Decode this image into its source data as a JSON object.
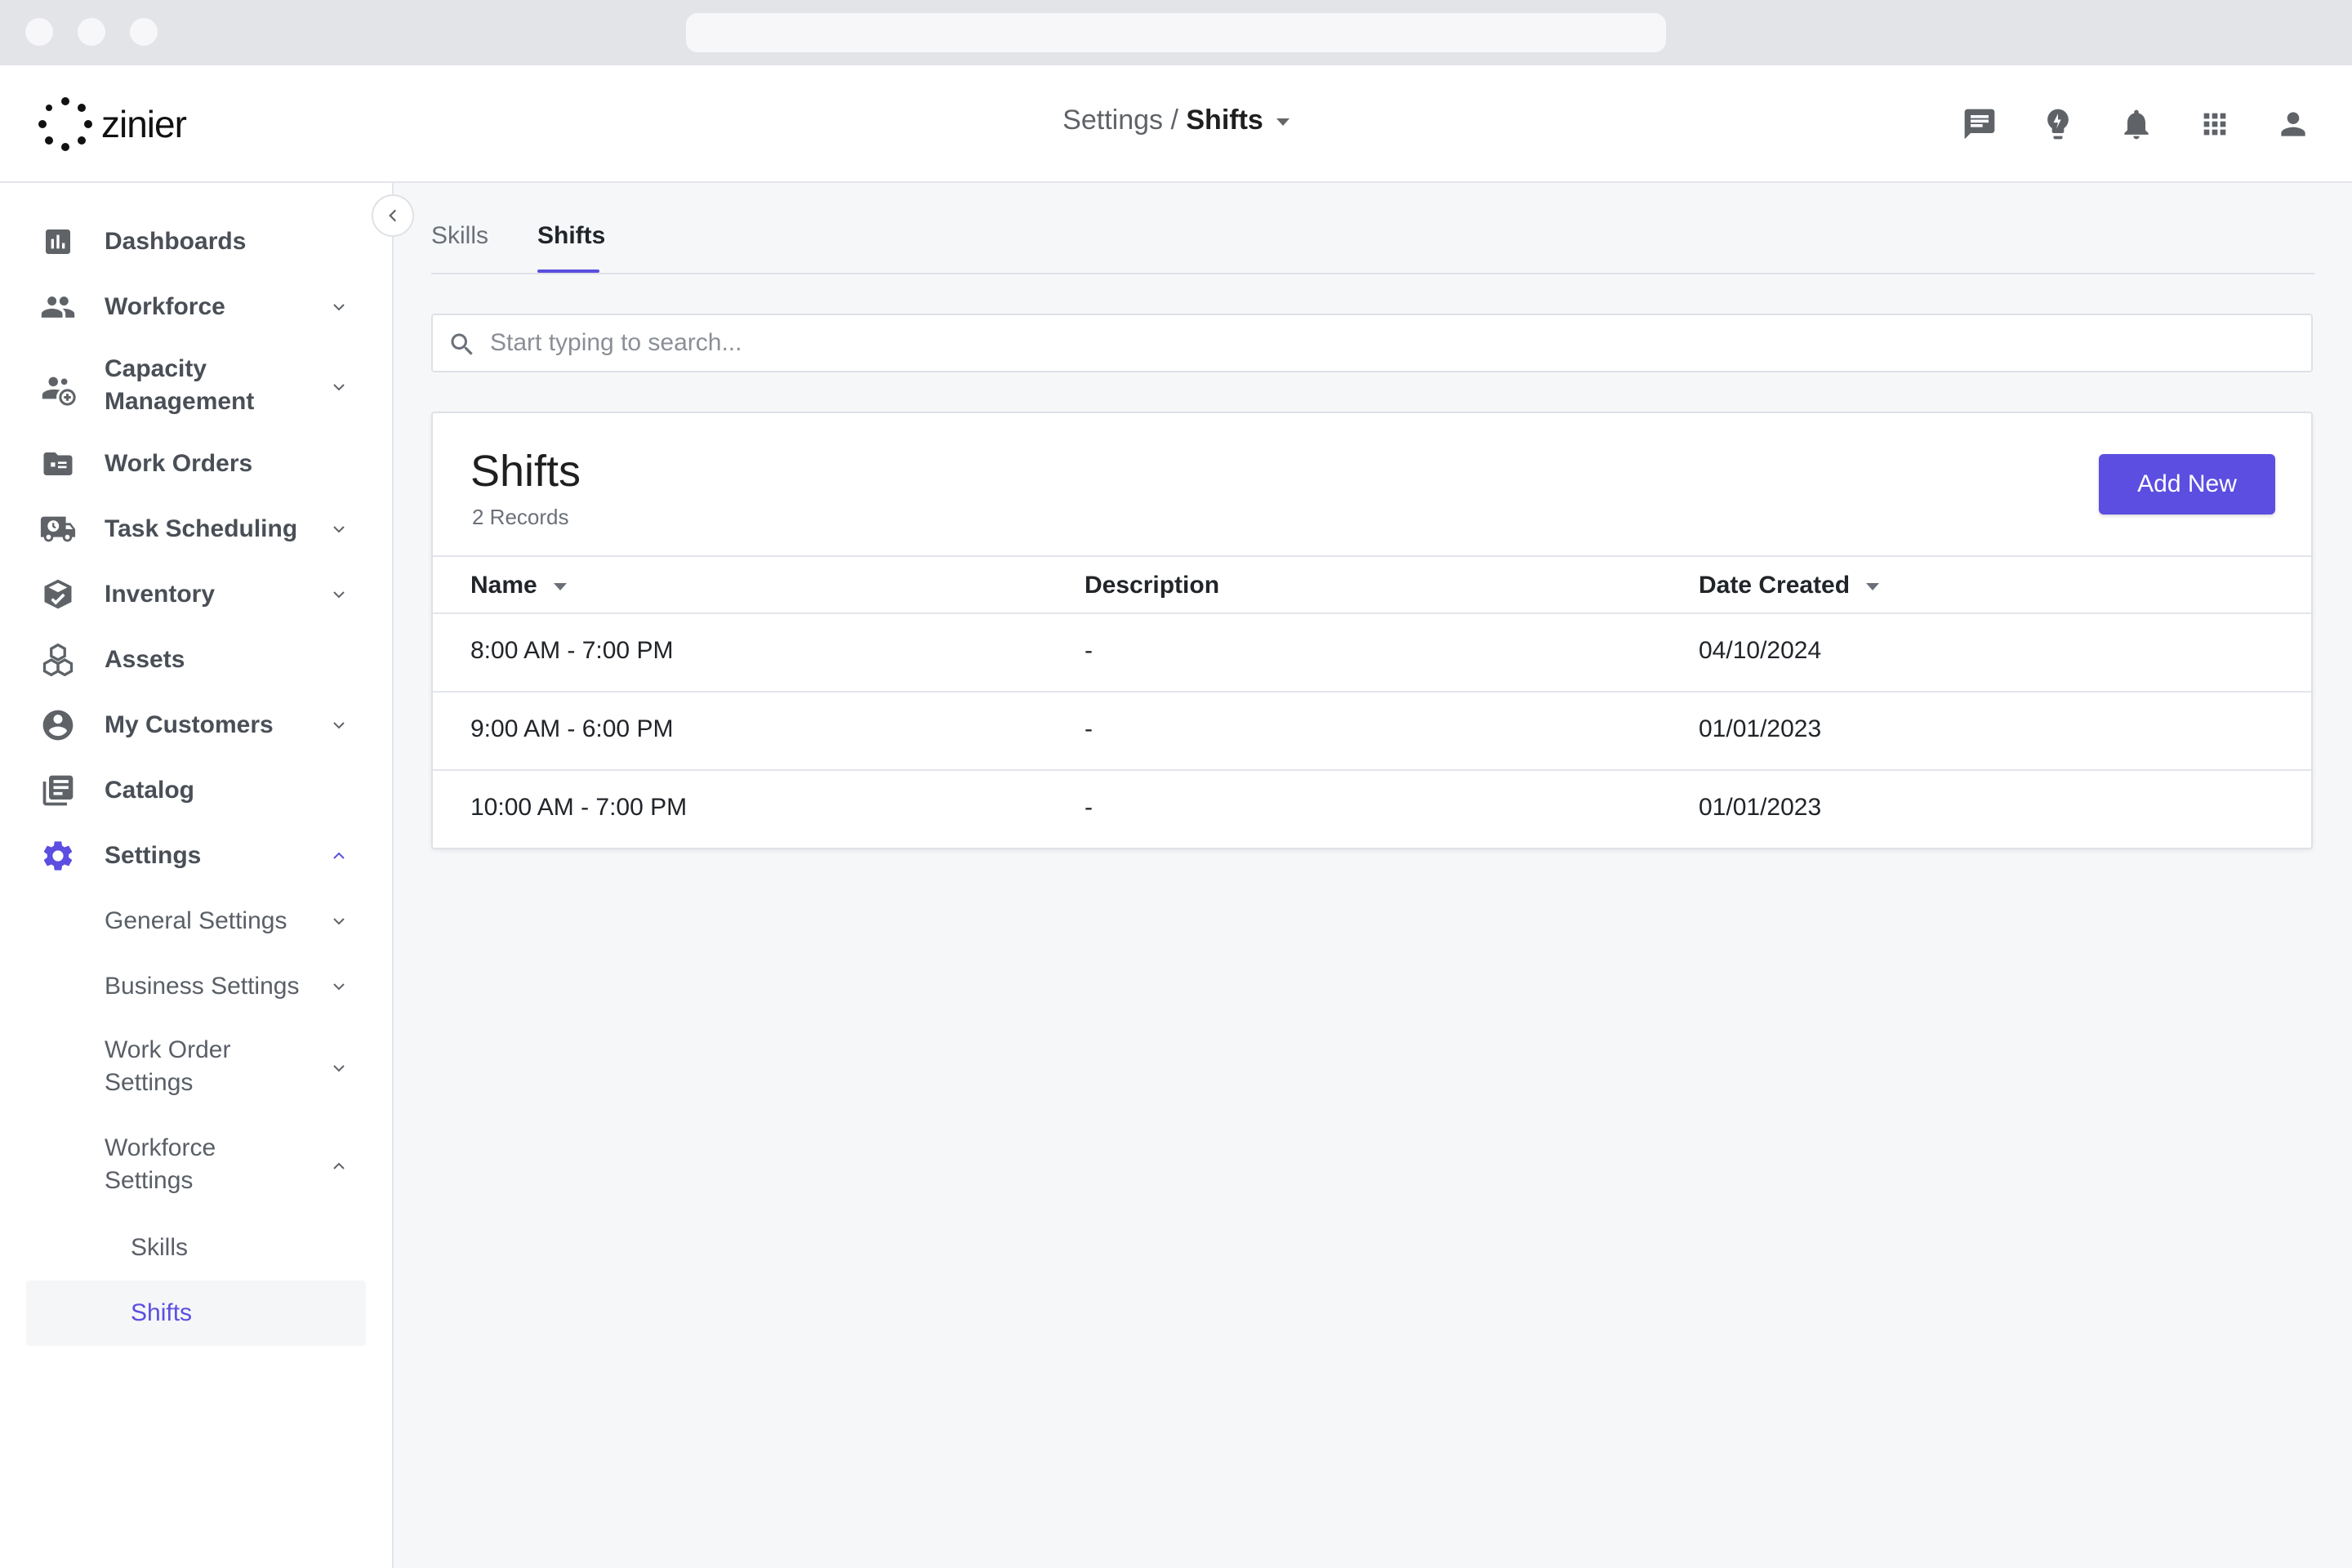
{
  "app": {
    "logo_text": "zinier"
  },
  "breadcrumb": {
    "parent": "Settings",
    "separator": " / ",
    "current": "Shifts"
  },
  "topbar_icons": [
    "chat-icon",
    "lightbulb-icon",
    "bell-icon",
    "apps-grid-icon",
    "user-icon"
  ],
  "sidebar": {
    "items": [
      {
        "label": "Dashboards",
        "icon": "bar-chart-icon",
        "expandable": false
      },
      {
        "label": "Workforce",
        "icon": "people-icon",
        "expandable": true
      },
      {
        "label": "Capacity",
        "label2": "Management",
        "icon": "people-add-icon",
        "expandable": true
      },
      {
        "label": "Work Orders",
        "icon": "folder-list-icon",
        "expandable": false
      },
      {
        "label": "Task Scheduling",
        "icon": "truck-clock-icon",
        "expandable": true
      },
      {
        "label": "Inventory",
        "icon": "box-check-icon",
        "expandable": true
      },
      {
        "label": "Assets",
        "icon": "cubes-icon",
        "expandable": false
      },
      {
        "label": "My Customers",
        "icon": "account-circle-icon",
        "expandable": true
      },
      {
        "label": "Catalog",
        "icon": "book-icon",
        "expandable": false
      },
      {
        "label": "Settings",
        "icon": "gear-icon",
        "expandable": true,
        "expanded": true
      }
    ],
    "settings_children": [
      {
        "label": "General Settings"
      },
      {
        "label": "Business Settings"
      },
      {
        "label": "Work Order",
        "label2": "Settings"
      },
      {
        "label": "Workforce",
        "label2": "Settings"
      }
    ],
    "workforce_children": [
      {
        "label": "Skills"
      },
      {
        "label": "Shifts",
        "active": true
      }
    ]
  },
  "tabs": [
    {
      "label": "Skills",
      "active": false
    },
    {
      "label": "Shifts",
      "active": true
    }
  ],
  "search": {
    "placeholder": "Start typing to search...",
    "value": ""
  },
  "card": {
    "title": "Shifts",
    "record_count": "2 Records",
    "add_button": "Add New",
    "columns": [
      "Name",
      "Description",
      "Date Created"
    ],
    "rows": [
      {
        "name": "8:00 AM - 7:00 PM",
        "description": "-",
        "date_created": "04/10/2024"
      },
      {
        "name": "9:00 AM - 6:00 PM",
        "description": "-",
        "date_created": "01/01/2023"
      },
      {
        "name": "10:00 AM - 7:00 PM",
        "description": "-",
        "date_created": "01/01/2023"
      }
    ]
  },
  "colors": {
    "accent": "#5b4ee0",
    "sidebar_icon": "#5f6368",
    "active_icon": "#5b4ee0"
  }
}
